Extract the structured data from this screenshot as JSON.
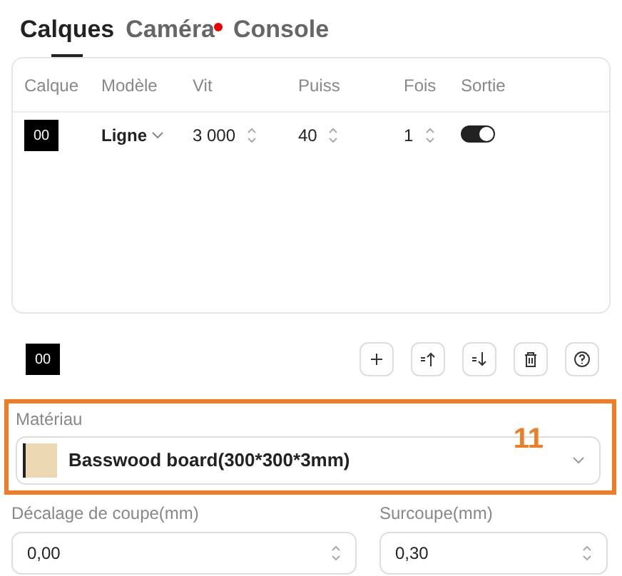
{
  "tabs": [
    {
      "label": "Calques",
      "selected": true,
      "dot": false
    },
    {
      "label": "Caméra",
      "selected": false,
      "dot": true
    },
    {
      "label": "Console",
      "selected": false,
      "dot": false
    }
  ],
  "table": {
    "columns": [
      "Calque",
      "Modèle",
      "Vit",
      "Puiss",
      "Fois",
      "Sortie"
    ],
    "rows": [
      {
        "layer": "00",
        "mode": "Ligne",
        "speed": "3 000",
        "power": "40",
        "passes": "1",
        "output": true
      }
    ]
  },
  "current_layer": "00",
  "toolbar": [
    {
      "kind": "add"
    },
    {
      "kind": "up"
    },
    {
      "kind": "down"
    },
    {
      "kind": "delete"
    },
    {
      "kind": "help"
    }
  ],
  "material": {
    "label": "Matériau",
    "value": "Basswood board(300*300*3mm)",
    "callout": "11"
  },
  "fields": [
    {
      "label": "Décalage de coupe(mm)",
      "value": "0,00"
    },
    {
      "label": "Surcoupe(mm)",
      "value": "0,30"
    }
  ]
}
